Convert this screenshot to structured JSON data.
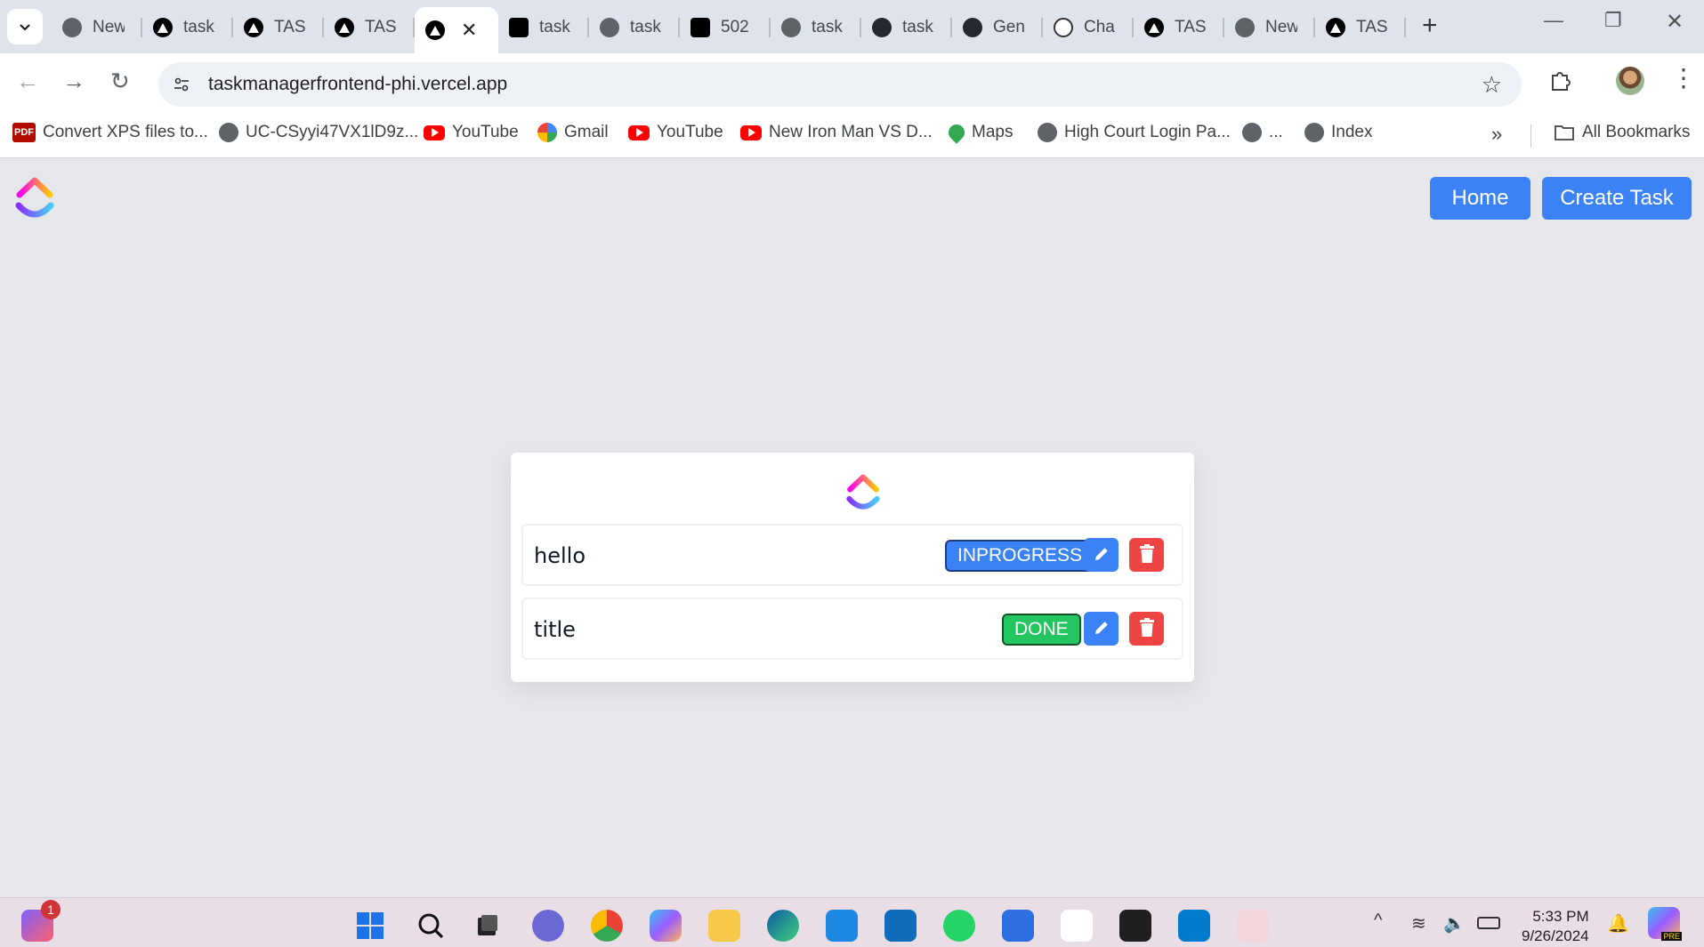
{
  "browser": {
    "tabs": [
      {
        "label": "New",
        "icon": "chrome-icon",
        "active": false
      },
      {
        "label": "task",
        "icon": "vercel-icon",
        "active": false
      },
      {
        "label": "TASK",
        "icon": "vercel-icon",
        "active": false
      },
      {
        "label": "TASK",
        "icon": "vercel-icon",
        "active": false
      },
      {
        "label": "",
        "icon": "vercel-icon",
        "active": true
      },
      {
        "label": "task",
        "icon": "render-icon",
        "active": false
      },
      {
        "label": "task",
        "icon": "globe-icon",
        "active": false
      },
      {
        "label": "502",
        "icon": "render-icon",
        "active": false
      },
      {
        "label": "task",
        "icon": "globe-icon",
        "active": false
      },
      {
        "label": "task",
        "icon": "github-icon",
        "active": false
      },
      {
        "label": "Gen",
        "icon": "github-icon",
        "active": false
      },
      {
        "label": "Cha",
        "icon": "chatgpt-icon",
        "active": false
      },
      {
        "label": "TASK",
        "icon": "vercel-icon",
        "active": false
      },
      {
        "label": "New",
        "icon": "chrome-icon",
        "active": false
      },
      {
        "label": "TASK",
        "icon": "vercel-icon",
        "active": false
      }
    ],
    "url": "taskmanagerfrontend-phi.vercel.app",
    "bookmarks": [
      {
        "label": "Convert XPS files to...",
        "icon": "pdf-icon"
      },
      {
        "label": "UC-CSyyi47VX1lD9z...",
        "icon": "globe-icon"
      },
      {
        "label": "YouTube",
        "icon": "youtube-icon"
      },
      {
        "label": "Gmail",
        "icon": "google-icon"
      },
      {
        "label": "YouTube",
        "icon": "youtube-icon"
      },
      {
        "label": "New Iron Man VS D...",
        "icon": "youtube-icon"
      },
      {
        "label": "Maps",
        "icon": "maps-icon"
      },
      {
        "label": "High Court Login Pa...",
        "icon": "globe-icon"
      },
      {
        "label": "...",
        "icon": "globe-icon"
      },
      {
        "label": "Index",
        "icon": "globe-icon"
      }
    ],
    "all_bookmarks": "All Bookmarks",
    "bookmarks_more": "»",
    "pdf_text": "PDF"
  },
  "app": {
    "nav": {
      "home_label": "Home",
      "create_label": "Create Task"
    },
    "tasks": [
      {
        "title": "hello",
        "status": "INPROGRESS",
        "status_color": "#3b82f6"
      },
      {
        "title": "title",
        "status": "DONE",
        "status_color": "#22c55e"
      }
    ],
    "colors": {
      "primary": "#3b82f6",
      "danger": "#ef4444",
      "success": "#22c55e",
      "background": "#e5e7eb"
    }
  },
  "taskbar": {
    "notification_count": "1",
    "time": "5:33 PM",
    "date": "9/26/2024",
    "pre_label": "PRE"
  }
}
